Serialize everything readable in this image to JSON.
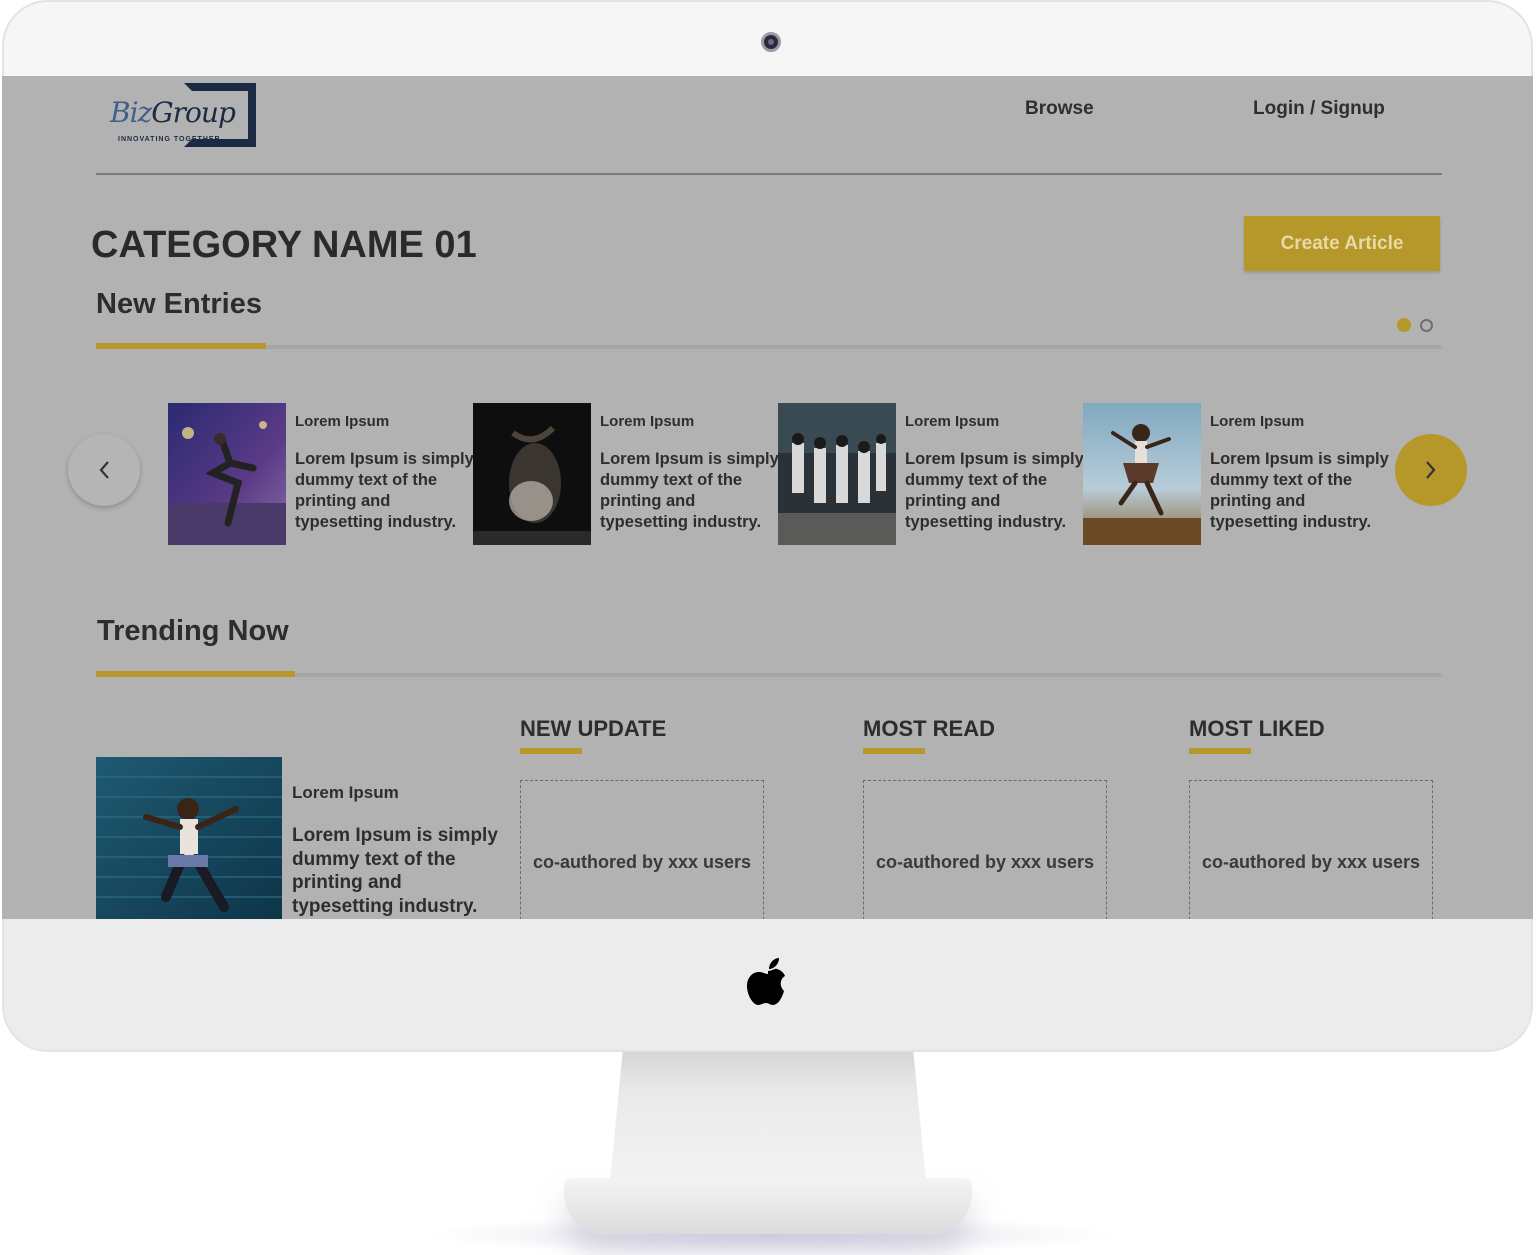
{
  "nav": {
    "browse": "Browse",
    "login": "Login / Signup"
  },
  "logo": {
    "biz": "Biz",
    "group": "Group",
    "tagline": "INNOVATING TOGETHER"
  },
  "page": {
    "title": "CATEGORY NAME 01",
    "create_button": "Create Article"
  },
  "new_entries": {
    "title": "New Entries",
    "cards": [
      {
        "title": "Lorem Ipsum",
        "body": "Lorem Ipsum is simply dummy text of the printing and typesetting industry."
      },
      {
        "title": "Lorem Ipsum",
        "body": "Lorem Ipsum is simply dummy text of the printing and typesetting industry."
      },
      {
        "title": "Lorem Ipsum",
        "body": "Lorem Ipsum is simply dummy text of the printing and typesetting industry."
      },
      {
        "title": "Lorem Ipsum",
        "body": "Lorem Ipsum is simply dummy text of the printing and typesetting industry."
      }
    ],
    "prev_icon": "chevron-left-icon",
    "next_icon": "chevron-right-icon"
  },
  "trending": {
    "title": "Trending Now",
    "featured": {
      "title": "Lorem Ipsum",
      "body": "Lorem Ipsum is simply dummy text of the printing and typesetting industry."
    },
    "columns": [
      {
        "heading": "NEW UPDATE",
        "text": "co-authored by xxx users"
      },
      {
        "heading": "MOST READ",
        "text": "co-authored by xxx users"
      },
      {
        "heading": "MOST LIKED",
        "text": "co-authored by xxx users"
      }
    ]
  },
  "colors": {
    "accent": "#b6982a",
    "screen_bg": "#b2b2b2",
    "text": "#2e2e2e",
    "logo_navy": "#1c2b44"
  }
}
